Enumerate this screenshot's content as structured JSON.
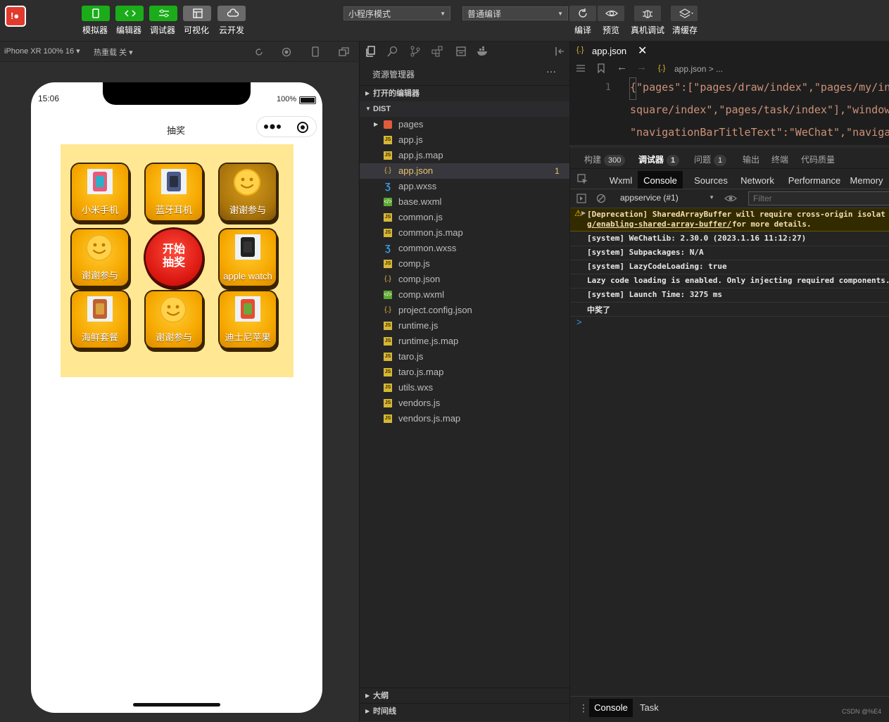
{
  "toolbar": {
    "buttons": [
      {
        "label": "模拟器",
        "style": "green"
      },
      {
        "label": "编辑器",
        "style": "green"
      },
      {
        "label": "调试器",
        "style": "green"
      },
      {
        "label": "可视化",
        "style": "gray"
      },
      {
        "label": "云开发",
        "style": "gray"
      }
    ],
    "mode_select": "小程序模式",
    "compile_select": "普通编译",
    "right_buttons": [
      {
        "label": "编译"
      },
      {
        "label": "预览"
      },
      {
        "label": "真机调试"
      },
      {
        "label": "清缓存"
      }
    ]
  },
  "simulator": {
    "device": "iPhone XR 100% 16",
    "hot_reload": "热重载 关",
    "status_time": "15:06",
    "battery": "100%",
    "nav_title": "抽奖",
    "prizes": [
      {
        "label": "小米手机",
        "kind": "image",
        "style": "normal"
      },
      {
        "label": "蓝牙耳机",
        "kind": "image",
        "style": "normal"
      },
      {
        "label": "谢谢参与",
        "kind": "smile",
        "style": "dark"
      },
      {
        "label": "谢谢参与",
        "kind": "smile",
        "style": "normal"
      },
      {
        "label": "开始\n抽奖",
        "kind": "start",
        "style": "start"
      },
      {
        "label": "apple watch",
        "kind": "image",
        "style": "normal"
      },
      {
        "label": "海鲜套餐",
        "kind": "image",
        "style": "normal"
      },
      {
        "label": "谢谢参与",
        "kind": "smile",
        "style": "normal"
      },
      {
        "label": "迪士尼苹果",
        "kind": "image",
        "style": "normal"
      }
    ]
  },
  "explorer": {
    "title": "资源管理器",
    "open_editors": "打开的编辑器",
    "root": "DIST",
    "files": [
      {
        "name": "pages",
        "type": "folder"
      },
      {
        "name": "app.js",
        "type": "js"
      },
      {
        "name": "app.js.map",
        "type": "js"
      },
      {
        "name": "app.json",
        "type": "json",
        "selected": true,
        "badge": "1"
      },
      {
        "name": "app.wxss",
        "type": "wxss"
      },
      {
        "name": "base.wxml",
        "type": "wxml"
      },
      {
        "name": "common.js",
        "type": "js"
      },
      {
        "name": "common.js.map",
        "type": "js"
      },
      {
        "name": "common.wxss",
        "type": "wxss"
      },
      {
        "name": "comp.js",
        "type": "js"
      },
      {
        "name": "comp.json",
        "type": "json"
      },
      {
        "name": "comp.wxml",
        "type": "wxml"
      },
      {
        "name": "project.config.json",
        "type": "json"
      },
      {
        "name": "runtime.js",
        "type": "js"
      },
      {
        "name": "runtime.js.map",
        "type": "js"
      },
      {
        "name": "taro.js",
        "type": "js"
      },
      {
        "name": "taro.js.map",
        "type": "js"
      },
      {
        "name": "utils.wxs",
        "type": "js"
      },
      {
        "name": "vendors.js",
        "type": "js"
      },
      {
        "name": "vendors.js.map",
        "type": "js"
      }
    ],
    "outline": "大纲",
    "timeline": "时间线"
  },
  "editor": {
    "tab": "app.json",
    "breadcrumb": "app.json > ...",
    "line_number": "1",
    "code_lines": [
      "{\"pages\":[\"pages/draw/index\",\"pages/my/ind",
      "square/index\",\"pages/task/index\"],\"window\"",
      "\"navigationBarTitleText\":\"WeChat\",\"navigat"
    ]
  },
  "debugger": {
    "top_tabs": [
      {
        "label": "构建",
        "badge": "300"
      },
      {
        "label": "调试器",
        "badge": "1",
        "active": true
      },
      {
        "label": "问题",
        "badge": "1"
      },
      {
        "label": "输出"
      },
      {
        "label": "终端"
      },
      {
        "label": "代码质量"
      }
    ],
    "panel_tabs": [
      "Wxml",
      "Console",
      "Sources",
      "Network",
      "Performance",
      "Memory"
    ],
    "active_panel": "Console",
    "context": "appservice (#1)",
    "filter_placeholder": "Filter",
    "warning_line1": "[Deprecation] SharedArrayBuffer will require cross-origin isolat",
    "warning_link": "g/enabling-shared-array-buffer/",
    "warning_tail": " for more details.",
    "logs": [
      "[system] WeChatLib: 2.30.0 (2023.1.16 11:12:27)",
      "[system] Subpackages: N/A",
      "[system] LazyCodeLoading: true",
      "Lazy code loading is enabled. Only injecting required components.",
      "[system] Launch Time: 3275 ms",
      "中奖了"
    ],
    "prompt": ">",
    "bottom_tabs": [
      "Console",
      "Task"
    ],
    "watermark": "CSDN @%E4"
  },
  "colors": {
    "accent_green": "#1aad19",
    "lottery_bg": "#ffe794",
    "cell_orange": "#f6a800",
    "start_red": "#d8150f"
  }
}
